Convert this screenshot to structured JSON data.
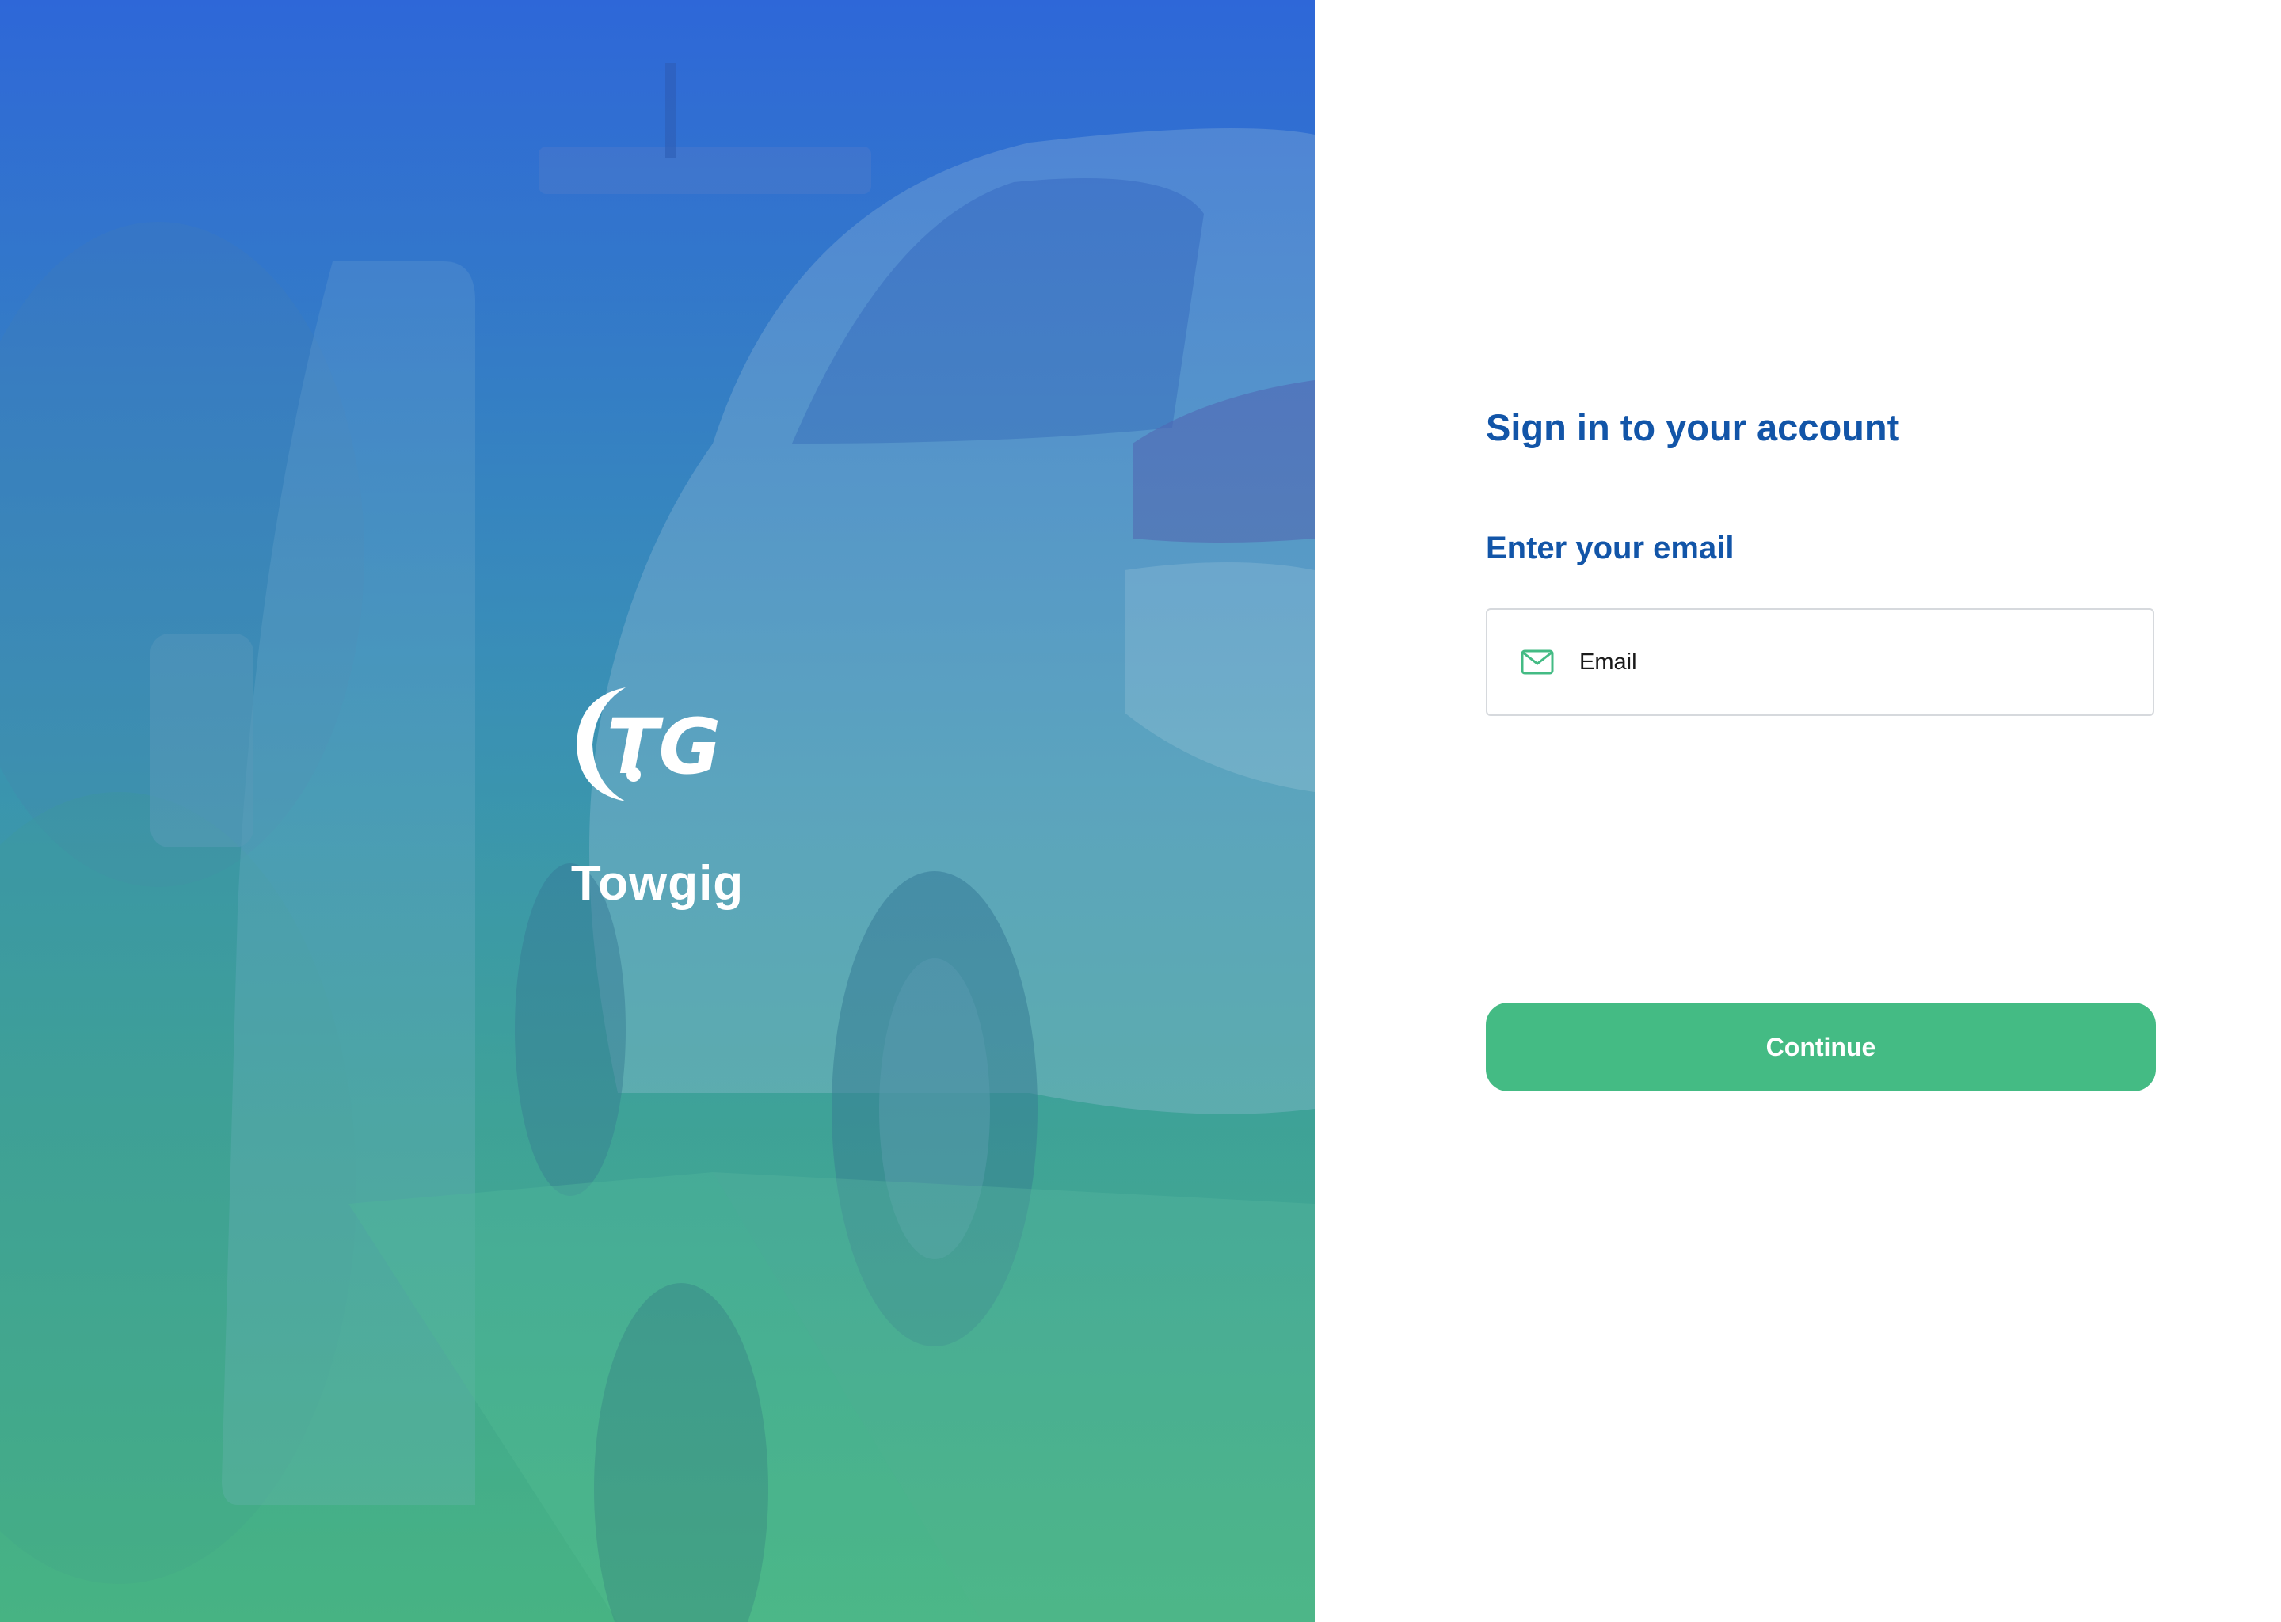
{
  "brand": {
    "name": "Towgig",
    "logo_text": "TG"
  },
  "form": {
    "title": "Sign in to your account",
    "email_label": "Enter your email",
    "email_placeholder": "Email",
    "email_value": "",
    "continue_label": "Continue"
  },
  "icons": {
    "email_field": "mail-icon"
  },
  "colors": {
    "title": "#1255a8",
    "accent": "#44bb84",
    "hero_top": "#2e67d8",
    "hero_bottom": "#47b383"
  }
}
